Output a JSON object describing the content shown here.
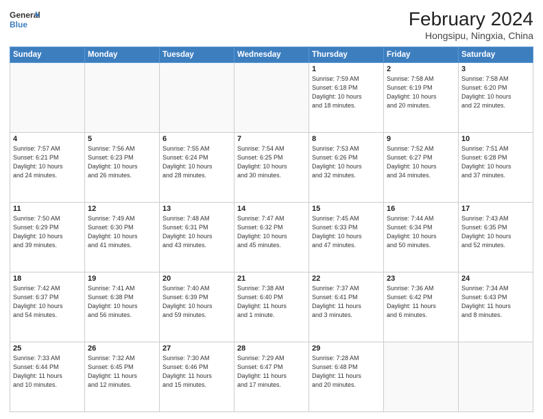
{
  "header": {
    "title": "February 2024",
    "subtitle": "Hongsipu, Ningxia, China",
    "logo_line1": "General",
    "logo_line2": "Blue"
  },
  "weekdays": [
    "Sunday",
    "Monday",
    "Tuesday",
    "Wednesday",
    "Thursday",
    "Friday",
    "Saturday"
  ],
  "weeks": [
    [
      {
        "day": "",
        "info": ""
      },
      {
        "day": "",
        "info": ""
      },
      {
        "day": "",
        "info": ""
      },
      {
        "day": "",
        "info": ""
      },
      {
        "day": "1",
        "info": "Sunrise: 7:59 AM\nSunset: 6:18 PM\nDaylight: 10 hours\nand 18 minutes."
      },
      {
        "day": "2",
        "info": "Sunrise: 7:58 AM\nSunset: 6:19 PM\nDaylight: 10 hours\nand 20 minutes."
      },
      {
        "day": "3",
        "info": "Sunrise: 7:58 AM\nSunset: 6:20 PM\nDaylight: 10 hours\nand 22 minutes."
      }
    ],
    [
      {
        "day": "4",
        "info": "Sunrise: 7:57 AM\nSunset: 6:21 PM\nDaylight: 10 hours\nand 24 minutes."
      },
      {
        "day": "5",
        "info": "Sunrise: 7:56 AM\nSunset: 6:23 PM\nDaylight: 10 hours\nand 26 minutes."
      },
      {
        "day": "6",
        "info": "Sunrise: 7:55 AM\nSunset: 6:24 PM\nDaylight: 10 hours\nand 28 minutes."
      },
      {
        "day": "7",
        "info": "Sunrise: 7:54 AM\nSunset: 6:25 PM\nDaylight: 10 hours\nand 30 minutes."
      },
      {
        "day": "8",
        "info": "Sunrise: 7:53 AM\nSunset: 6:26 PM\nDaylight: 10 hours\nand 32 minutes."
      },
      {
        "day": "9",
        "info": "Sunrise: 7:52 AM\nSunset: 6:27 PM\nDaylight: 10 hours\nand 34 minutes."
      },
      {
        "day": "10",
        "info": "Sunrise: 7:51 AM\nSunset: 6:28 PM\nDaylight: 10 hours\nand 37 minutes."
      }
    ],
    [
      {
        "day": "11",
        "info": "Sunrise: 7:50 AM\nSunset: 6:29 PM\nDaylight: 10 hours\nand 39 minutes."
      },
      {
        "day": "12",
        "info": "Sunrise: 7:49 AM\nSunset: 6:30 PM\nDaylight: 10 hours\nand 41 minutes."
      },
      {
        "day": "13",
        "info": "Sunrise: 7:48 AM\nSunset: 6:31 PM\nDaylight: 10 hours\nand 43 minutes."
      },
      {
        "day": "14",
        "info": "Sunrise: 7:47 AM\nSunset: 6:32 PM\nDaylight: 10 hours\nand 45 minutes."
      },
      {
        "day": "15",
        "info": "Sunrise: 7:45 AM\nSunset: 6:33 PM\nDaylight: 10 hours\nand 47 minutes."
      },
      {
        "day": "16",
        "info": "Sunrise: 7:44 AM\nSunset: 6:34 PM\nDaylight: 10 hours\nand 50 minutes."
      },
      {
        "day": "17",
        "info": "Sunrise: 7:43 AM\nSunset: 6:35 PM\nDaylight: 10 hours\nand 52 minutes."
      }
    ],
    [
      {
        "day": "18",
        "info": "Sunrise: 7:42 AM\nSunset: 6:37 PM\nDaylight: 10 hours\nand 54 minutes."
      },
      {
        "day": "19",
        "info": "Sunrise: 7:41 AM\nSunset: 6:38 PM\nDaylight: 10 hours\nand 56 minutes."
      },
      {
        "day": "20",
        "info": "Sunrise: 7:40 AM\nSunset: 6:39 PM\nDaylight: 10 hours\nand 59 minutes."
      },
      {
        "day": "21",
        "info": "Sunrise: 7:38 AM\nSunset: 6:40 PM\nDaylight: 11 hours\nand 1 minute."
      },
      {
        "day": "22",
        "info": "Sunrise: 7:37 AM\nSunset: 6:41 PM\nDaylight: 11 hours\nand 3 minutes."
      },
      {
        "day": "23",
        "info": "Sunrise: 7:36 AM\nSunset: 6:42 PM\nDaylight: 11 hours\nand 6 minutes."
      },
      {
        "day": "24",
        "info": "Sunrise: 7:34 AM\nSunset: 6:43 PM\nDaylight: 11 hours\nand 8 minutes."
      }
    ],
    [
      {
        "day": "25",
        "info": "Sunrise: 7:33 AM\nSunset: 6:44 PM\nDaylight: 11 hours\nand 10 minutes."
      },
      {
        "day": "26",
        "info": "Sunrise: 7:32 AM\nSunset: 6:45 PM\nDaylight: 11 hours\nand 12 minutes."
      },
      {
        "day": "27",
        "info": "Sunrise: 7:30 AM\nSunset: 6:46 PM\nDaylight: 11 hours\nand 15 minutes."
      },
      {
        "day": "28",
        "info": "Sunrise: 7:29 AM\nSunset: 6:47 PM\nDaylight: 11 hours\nand 17 minutes."
      },
      {
        "day": "29",
        "info": "Sunrise: 7:28 AM\nSunset: 6:48 PM\nDaylight: 11 hours\nand 20 minutes."
      },
      {
        "day": "",
        "info": ""
      },
      {
        "day": "",
        "info": ""
      }
    ]
  ]
}
